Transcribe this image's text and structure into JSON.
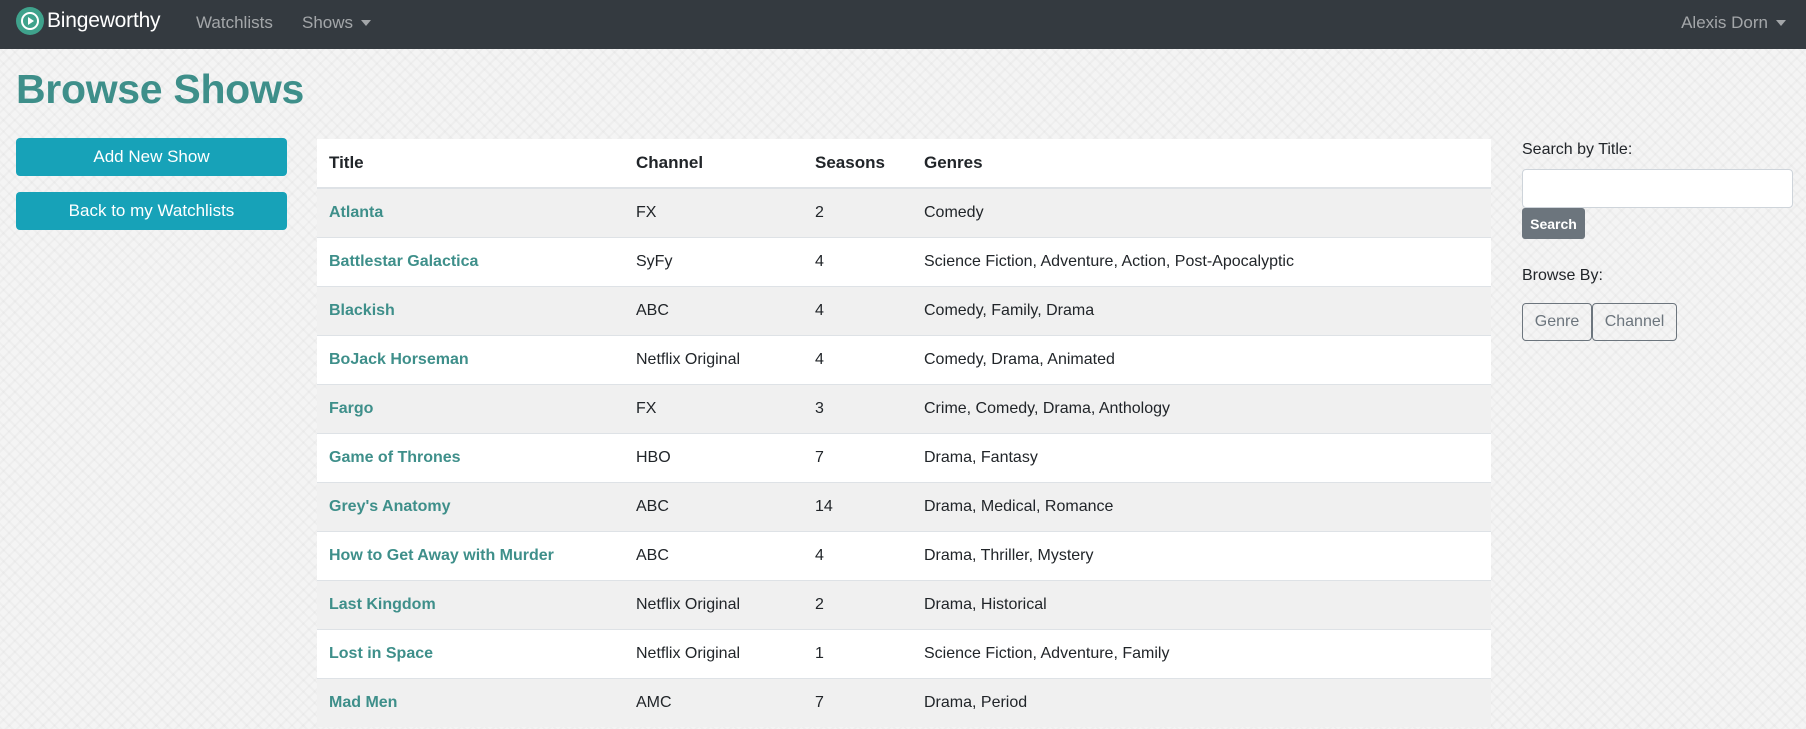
{
  "navbar": {
    "brand": "Bingeworthy",
    "links": {
      "watchlists": "Watchlists",
      "shows": "Shows"
    },
    "user": "Alexis Dorn"
  },
  "page": {
    "title": "Browse Shows"
  },
  "left_actions": {
    "add_show": "Add New Show",
    "back_to_watchlists": "Back to my Watchlists"
  },
  "table": {
    "headers": {
      "title": "Title",
      "channel": "Channel",
      "seasons": "Seasons",
      "genres": "Genres"
    },
    "rows": [
      {
        "title": "Atlanta",
        "channel": "FX",
        "seasons": "2",
        "genres": "Comedy"
      },
      {
        "title": "Battlestar Galactica",
        "channel": "SyFy",
        "seasons": "4",
        "genres": "Science Fiction, Adventure, Action, Post-Apocalyptic"
      },
      {
        "title": "Blackish",
        "channel": "ABC",
        "seasons": "4",
        "genres": "Comedy, Family, Drama"
      },
      {
        "title": "BoJack Horseman",
        "channel": "Netflix Original",
        "seasons": "4",
        "genres": "Comedy, Drama, Animated"
      },
      {
        "title": "Fargo",
        "channel": "FX",
        "seasons": "3",
        "genres": "Crime, Comedy, Drama, Anthology"
      },
      {
        "title": "Game of Thrones",
        "channel": "HBO",
        "seasons": "7",
        "genres": "Drama, Fantasy"
      },
      {
        "title": "Grey's Anatomy",
        "channel": "ABC",
        "seasons": "14",
        "genres": "Drama, Medical, Romance"
      },
      {
        "title": "How to Get Away with Murder",
        "channel": "ABC",
        "seasons": "4",
        "genres": "Drama, Thriller, Mystery"
      },
      {
        "title": "Last Kingdom",
        "channel": "Netflix Original",
        "seasons": "2",
        "genres": "Drama, Historical"
      },
      {
        "title": "Lost in Space",
        "channel": "Netflix Original",
        "seasons": "1",
        "genres": "Science Fiction, Adventure, Family"
      },
      {
        "title": "Mad Men",
        "channel": "AMC",
        "seasons": "7",
        "genres": "Drama, Period"
      }
    ]
  },
  "sidebar": {
    "search_label": "Search by Title:",
    "search_value": "",
    "search_button": "Search",
    "browse_label": "Browse By:",
    "browse_options": {
      "genre": "Genre",
      "channel": "Channel"
    }
  },
  "colors": {
    "navbar_bg": "#343a40",
    "brand_accent": "#3fa28c",
    "title_teal": "#3e8f8a",
    "button_teal": "#17a2b8",
    "button_secondary": "#6c757d"
  },
  "icons": {
    "brand": "play-circle-icon",
    "dropdown": "caret-down-icon"
  }
}
